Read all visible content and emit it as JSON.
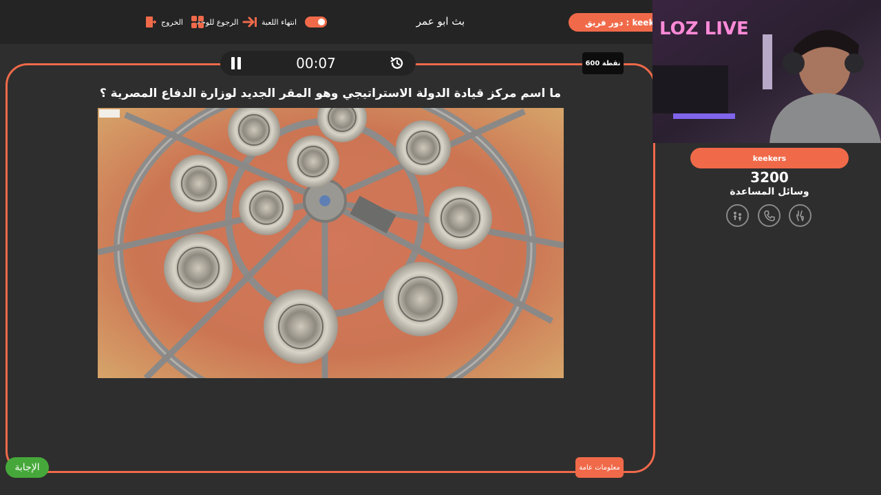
{
  "topbar": {
    "end_game_label": "انتهاء اللعبة",
    "back_to_board_label": "الرجوع للوحة",
    "exit_label": "الخروج",
    "host_title": "بث ابو عمر",
    "team_turn_label": "دور فريق : keekers"
  },
  "timer": {
    "time": "00:07"
  },
  "question": {
    "points_label": "600 نقطة",
    "text": "ما اسم مركز قيادة الدولة الاستراتيجي وهو المقر الجديد لوزارة الدفاع المصرية ؟",
    "category_label": "معلومات عامة",
    "answer_label": "الإجابة"
  },
  "sidebar": {
    "team_name": "keekers",
    "score": "3200",
    "aids_label": "وسائل المساعدة",
    "lifelines": [
      "two-players-icon",
      "phone-call-icon",
      "hand-icon"
    ]
  },
  "webcam": {
    "neon_sign": "LOZ LIVE"
  },
  "colors": {
    "accent": "#f06a4a",
    "answer": "#46a83a",
    "background": "#2e2e2e"
  }
}
